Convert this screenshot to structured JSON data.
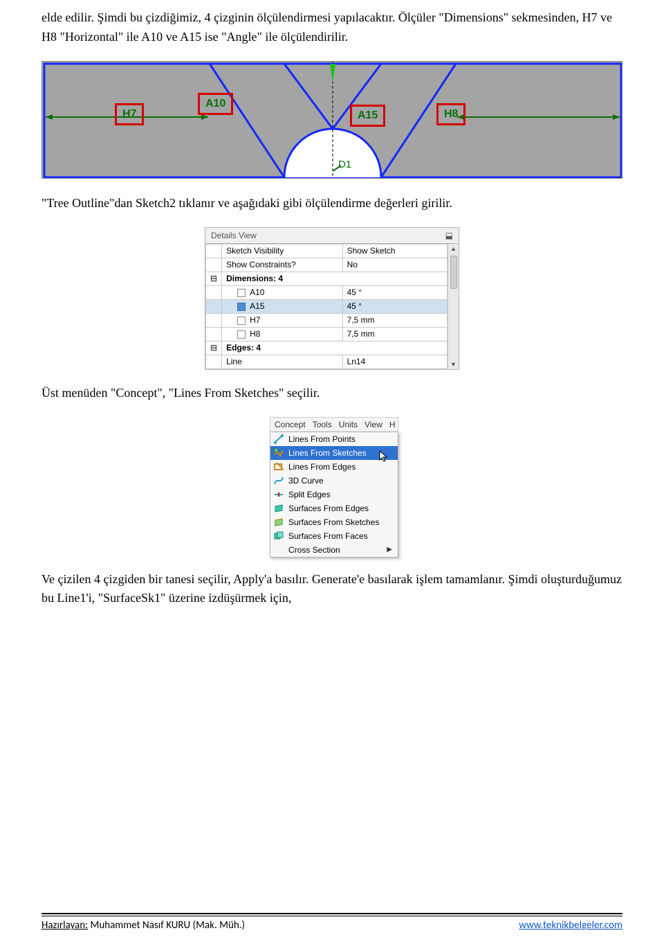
{
  "paragraphs": {
    "p1": "elde edilir. Şimdi bu çizdiğimiz, 4 çizginin ölçülendirmesi yapılacaktır. Ölçüler \"Dimensions\" sekmesinden, H7 ve H8 \"Horizontal\" ile A10 ve A15 ise \"Angle\" ile ölçülendirilir.",
    "p2": "\"Tree Outline\"dan Sketch2 tıklanır ve aşağıdaki gibi ölçülendirme değerleri girilir.",
    "p3": "Üst menüden \"Concept\", \"Lines From Sketches\" seçilir.",
    "p4": "Ve çizilen 4 çizgiden bir tanesi seçilir, Apply'a basılır. Generate'e basılarak işlem tamamlanır. Şimdi oluşturduğumuz bu Line1'i, \"SurfaceSk1\" üzerine izdüşürmek için,"
  },
  "sketch": {
    "labels": {
      "h7": "H7",
      "a10": "A10",
      "a15": "A15",
      "h8": "H8",
      "d1": "D1"
    }
  },
  "details": {
    "title": "Details View",
    "rows": [
      {
        "type": "row",
        "key": "Sketch Visibility",
        "val": "Show Sketch"
      },
      {
        "type": "row",
        "key": "Show Constraints?",
        "val": "No"
      },
      {
        "type": "group",
        "key": "Dimensions: 4"
      },
      {
        "type": "row",
        "key": "A10",
        "val": "45 °",
        "chk": true
      },
      {
        "type": "row",
        "key": "A15",
        "val": "45 °",
        "chk": true,
        "selected": true
      },
      {
        "type": "row",
        "key": "H7",
        "val": "7,5 mm",
        "chk": true
      },
      {
        "type": "row",
        "key": "H8",
        "val": "7,5 mm",
        "chk": true
      },
      {
        "type": "group",
        "key": "Edges: 4"
      },
      {
        "type": "row",
        "key": "Line",
        "val": "Ln14"
      }
    ]
  },
  "menu": {
    "bar": [
      "Concept",
      "Tools",
      "Units",
      "View",
      "H"
    ],
    "items": [
      {
        "label": "Lines From Points",
        "icon": "lines-from-points-icon"
      },
      {
        "label": "Lines From Sketches",
        "icon": "lines-from-sketches-icon",
        "selected": true
      },
      {
        "label": "Lines From Edges",
        "icon": "lines-from-edges-icon"
      },
      {
        "label": "3D Curve",
        "icon": "curve-3d-icon"
      },
      {
        "label": "Split Edges",
        "icon": "split-edges-icon"
      },
      {
        "label": "Surfaces From Edges",
        "icon": "surfaces-from-edges-icon"
      },
      {
        "label": "Surfaces From Sketches",
        "icon": "surfaces-from-sketches-icon"
      },
      {
        "label": "Surfaces From Faces",
        "icon": "surfaces-from-faces-icon"
      },
      {
        "label": "Cross Section",
        "icon": "cross-section-icon",
        "submenu": true
      }
    ]
  },
  "footer": {
    "left_label": "Hazırlayan:",
    "left_name": " Muhammet Nasıf KURU (Mak. Müh.)",
    "right": "www.teknikbelgeler.com"
  }
}
